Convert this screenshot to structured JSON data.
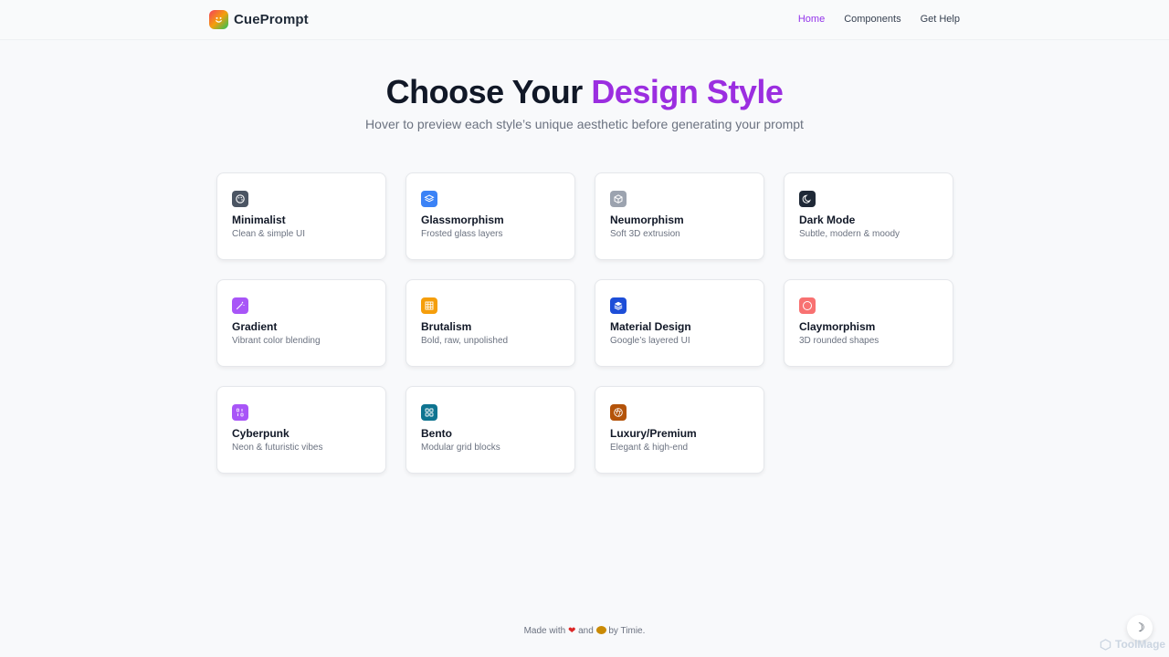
{
  "brand": {
    "name": "CuePrompt"
  },
  "nav": {
    "links": [
      {
        "label": "Home",
        "active": true
      },
      {
        "label": "Components",
        "active": false
      },
      {
        "label": "Get Help",
        "active": false
      }
    ]
  },
  "hero": {
    "title_prefix": "Choose Your ",
    "title_accent": "Design Style",
    "subtitle": "Hover to preview each style’s unique aesthetic before generating your prompt"
  },
  "styles": [
    {
      "title": "Minimalist",
      "desc": "Clean & simple UI",
      "icon": "palette-icon",
      "color": "#4b5563"
    },
    {
      "title": "Glassmorphism",
      "desc": "Frosted glass layers",
      "icon": "layers-icon",
      "color": "#3b82f6"
    },
    {
      "title": "Neumorphism",
      "desc": "Soft 3D extrusion",
      "icon": "cube-icon",
      "color": "#9ca3af"
    },
    {
      "title": "Dark Mode",
      "desc": "Subtle, modern & moody",
      "icon": "moon-icon",
      "color": "#1f2937"
    },
    {
      "title": "Gradient",
      "desc": "Vibrant color blending",
      "icon": "wand-icon",
      "color": "#a855f7"
    },
    {
      "title": "Brutalism",
      "desc": "Bold, raw, unpolished",
      "icon": "grid-icon",
      "color": "#f59e0b"
    },
    {
      "title": "Material Design",
      "desc": "Google’s layered UI",
      "icon": "stack-icon",
      "color": "#1d4ed8"
    },
    {
      "title": "Claymorphism",
      "desc": "3D rounded shapes",
      "icon": "circle-icon",
      "color": "#f87171"
    },
    {
      "title": "Cyberpunk",
      "desc": "Neon & futuristic vibes",
      "icon": "binary-icon",
      "color": "#a855f7"
    },
    {
      "title": "Bento",
      "desc": "Modular grid blocks",
      "icon": "boxes-icon",
      "color": "#0e7490"
    },
    {
      "title": "Luxury/Premium",
      "desc": "Elegant & high-end",
      "icon": "gem-icon",
      "color": "#b45309"
    }
  ],
  "footer": {
    "prefix": "Made with",
    "and": "and",
    "suffix": "by Timie."
  },
  "theme_toggle": {
    "icon": "moon-icon"
  },
  "watermark": {
    "text": "ToolMage"
  }
}
